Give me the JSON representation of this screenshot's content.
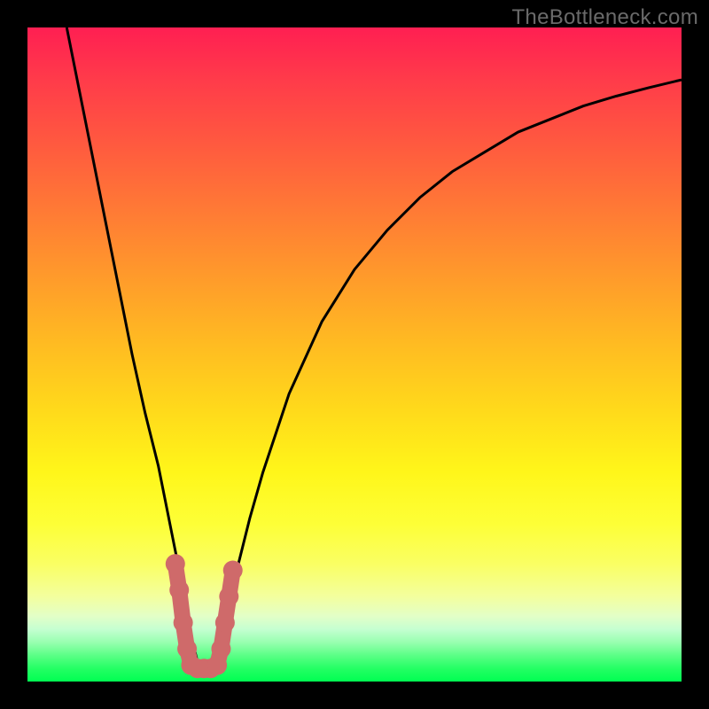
{
  "watermark": "TheBottleneck.com",
  "chart_data": {
    "type": "line",
    "title": "",
    "xlabel": "",
    "ylabel": "",
    "xlim": [
      0,
      100
    ],
    "ylim": [
      0,
      100
    ],
    "grid": false,
    "series": [
      {
        "name": "bottleneck-curve",
        "color": "#000000",
        "x": [
          6,
          8,
          10,
          12,
          14,
          16,
          18,
          20,
          22,
          23,
          24,
          25,
          26,
          27,
          28,
          29,
          30,
          31,
          32,
          34,
          36,
          40,
          45,
          50,
          55,
          60,
          65,
          70,
          75,
          80,
          85,
          90,
          95,
          100
        ],
        "y": [
          100,
          90,
          80,
          70,
          60,
          50,
          41,
          33,
          23,
          18,
          12,
          7,
          3,
          2,
          2,
          3,
          7,
          12,
          17,
          25,
          32,
          44,
          55,
          63,
          69,
          74,
          78,
          81,
          84,
          86,
          88,
          89.5,
          90.8,
          92
        ]
      },
      {
        "name": "left-highlight",
        "color": "#cf6a6a",
        "thick": true,
        "x": [
          22.6,
          23.2,
          23.8,
          24.4,
          25.0
        ],
        "y": [
          18,
          14,
          9,
          5,
          2.5
        ]
      },
      {
        "name": "bottom-highlight",
        "color": "#cf6a6a",
        "thick": true,
        "x": [
          25.0,
          26.0,
          27.0,
          28.0,
          29.0
        ],
        "y": [
          2.5,
          2,
          2,
          2,
          2.5
        ]
      },
      {
        "name": "right-highlight",
        "color": "#cf6a6a",
        "thick": true,
        "x": [
          29.0,
          29.6,
          30.2,
          30.8,
          31.4
        ],
        "y": [
          2.5,
          5,
          9,
          13,
          17
        ]
      }
    ]
  }
}
